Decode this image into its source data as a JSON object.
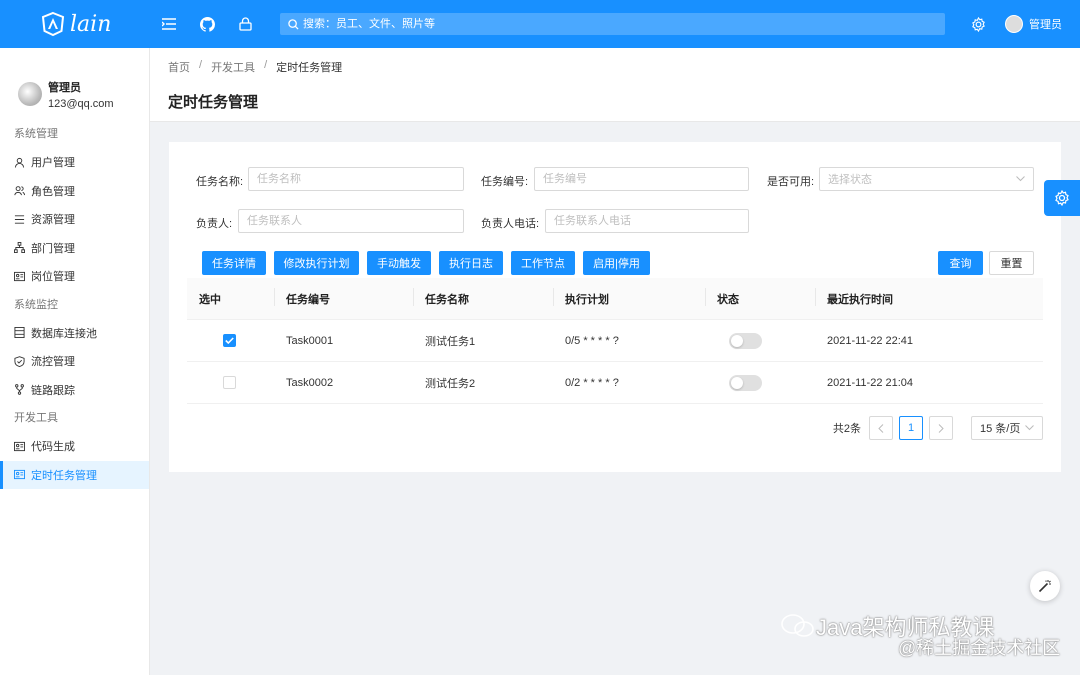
{
  "header": {
    "logo_text": "lain",
    "search_placeholder": "搜索：员工、文件、照片等",
    "user_name": "管理员"
  },
  "sidebar": {
    "user": {
      "name": "管理员",
      "email": "123@qq.com"
    },
    "groups": [
      {
        "title": "系统管理",
        "items": [
          {
            "label": "用户管理",
            "icon": "user-icon"
          },
          {
            "label": "角色管理",
            "icon": "users-icon"
          },
          {
            "label": "资源管理",
            "icon": "list-icon"
          },
          {
            "label": "部门管理",
            "icon": "org-tree-icon"
          },
          {
            "label": "岗位管理",
            "icon": "id-card-icon"
          }
        ]
      },
      {
        "title": "系统监控",
        "items": [
          {
            "label": "数据库连接池",
            "icon": "database-icon"
          },
          {
            "label": "流控管理",
            "icon": "shield-icon"
          },
          {
            "label": "链路跟踪",
            "icon": "fork-icon"
          }
        ]
      },
      {
        "title": "开发工具",
        "items": [
          {
            "label": "代码生成",
            "icon": "code-card-icon"
          },
          {
            "label": "定时任务管理",
            "icon": "schedule-card-icon",
            "active": true
          }
        ]
      }
    ]
  },
  "breadcrumb": [
    "首页",
    "开发工具",
    "定时任务管理"
  ],
  "page_title": "定时任务管理",
  "form": {
    "task_name": {
      "label": "任务名称:",
      "placeholder": "任务名称"
    },
    "task_code": {
      "label": "任务编号:",
      "placeholder": "任务编号"
    },
    "enabled": {
      "label": "是否可用:",
      "placeholder": "选择状态"
    },
    "owner": {
      "label": "负责人:",
      "placeholder": "任务联系人"
    },
    "owner_phone": {
      "label": "负责人电话:",
      "placeholder": "任务联系人电话"
    }
  },
  "actions": [
    "任务详情",
    "修改执行计划",
    "手动触发",
    "执行日志",
    "工作节点",
    "启用|停用"
  ],
  "query_label": "查询",
  "reset_label": "重置",
  "table": {
    "columns": [
      "选中",
      "任务编号",
      "任务名称",
      "执行计划",
      "状态",
      "最近执行时间"
    ],
    "rows": [
      {
        "checked": true,
        "code": "Task0001",
        "name": "测试任务1",
        "cron": "0/5 * * * * ?",
        "enabled": false,
        "last_run": "2021-11-22 22:41"
      },
      {
        "checked": false,
        "code": "Task0002",
        "name": "测试任务2",
        "cron": "0/2 * * * * ?",
        "enabled": false,
        "last_run": "2021-11-22 21:04"
      }
    ]
  },
  "pagination": {
    "total_label": "共2条",
    "current_page": "1",
    "page_size": "15 条/页"
  },
  "watermark": {
    "line1": "Java架构师私教课",
    "line2": "@稀土掘金技术社区"
  },
  "colors": {
    "primary": "#1890ff",
    "background": "#f0f2f5"
  }
}
